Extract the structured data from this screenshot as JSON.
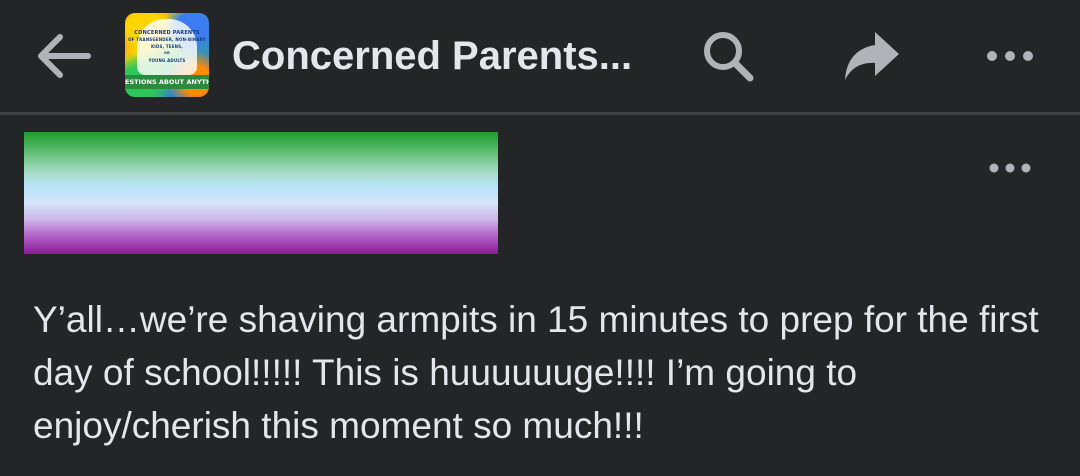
{
  "header": {
    "title": "Concerned Parents...",
    "icons": {
      "back": "back-arrow-icon",
      "search": "search-icon",
      "share": "share-icon",
      "more": "more-icon"
    },
    "avatar": {
      "lines": [
        "CONCERNED PARENTS",
        "OF TRANSGENDER, NON-BINARY",
        "KIDS, TEENS,",
        "OR",
        "YOUNG ADULTS"
      ],
      "banner": "ESTIONS ABOUT ANYTHING A"
    }
  },
  "post": {
    "body": "Y’all…we’re shaving armpits in 15 minutes to prep for the first day of school!!!!! This is huuuuuuge!!!! I’m going to enjoy/cherish this moment so much!!!",
    "more_icon": "more-icon"
  },
  "colors": {
    "background": "#242526",
    "text": "#e4e6eb",
    "icon": "#b0b3b8",
    "flag_green": "#1e9c2e",
    "flag_blue": "#b8e3f7",
    "flag_purple": "#8c1a99"
  }
}
